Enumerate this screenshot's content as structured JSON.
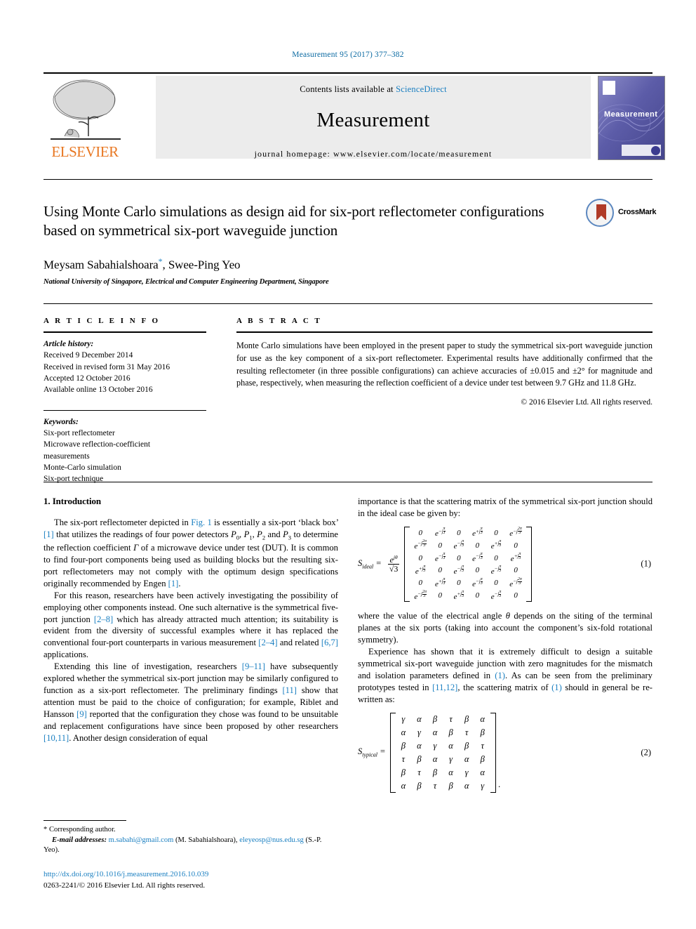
{
  "running_head": "Measurement 95 (2017) 377–382",
  "masthead": {
    "publisher": "ELSEVIER",
    "contents_prefix": "Contents lists available at ",
    "contents_link": "ScienceDirect",
    "journal_title": "Measurement",
    "homepage": "journal homepage: www.elsevier.com/locate/measurement",
    "cover_label": "Measurement"
  },
  "title_block": {
    "title": "Using Monte Carlo simulations as design aid for six-port reflectometer configurations based on symmetrical six-port waveguide junction",
    "authors_part1": "Meysam Sabahialshoara",
    "corresponding_marker": "*",
    "authors_part2": ", Swee-Ping Yeo",
    "affiliation": "National University of Singapore, Electrical and Computer Engineering Department, Singapore",
    "crossmark_label": "CrossMark"
  },
  "article_info": {
    "heading": "A R T I C L E   I N F O",
    "history_label": "Article history:",
    "history": [
      "Received 9 December 2014",
      "Received in revised form 31 May 2016",
      "Accepted 12 October 2016",
      "Available online 13 October 2016"
    ],
    "keywords_label": "Keywords:",
    "keywords": [
      "Six-port reflectometer",
      "Microwave reflection-coefficient",
      "measurements",
      "Monte-Carlo simulation",
      "Six-port technique"
    ]
  },
  "abstract": {
    "heading": "A B S T R A C T",
    "text": "Monte Carlo simulations have been employed in the present paper to study the symmetrical six-port waveguide junction for use as the key component of a six-port reflectometer. Experimental results have additionally confirmed that the resulting reflectometer (in three possible configurations) can achieve accuracies of ±0.015 and ±2° for magnitude and phase, respectively, when measuring the reflection coefficient of a device under test between 9.7 GHz and 11.8 GHz.",
    "copyright": "© 2016 Elsevier Ltd. All rights reserved."
  },
  "body": {
    "section1_heading": "1. Introduction",
    "left_paragraphs": [
      {
        "segments": [
          {
            "t": "The six-port reflectometer depicted in "
          },
          {
            "t": "Fig. 1",
            "s": "ref"
          },
          {
            "t": " is essentially a six-port ‘black box’ "
          },
          {
            "t": "[1]",
            "s": "ref"
          },
          {
            "t": " that utilizes the readings of four power detectors "
          },
          {
            "t": "P",
            "s": "it"
          },
          {
            "t": "0",
            "s": "sub"
          },
          {
            "t": ", "
          },
          {
            "t": "P",
            "s": "it"
          },
          {
            "t": "1",
            "s": "sub"
          },
          {
            "t": ", "
          },
          {
            "t": "P",
            "s": "it"
          },
          {
            "t": "2",
            "s": "sub"
          },
          {
            "t": " and "
          },
          {
            "t": "P",
            "s": "it"
          },
          {
            "t": "3",
            "s": "sub"
          },
          {
            "t": " to determine the reflection coefficient "
          },
          {
            "t": "Γ",
            "s": "it"
          },
          {
            "t": " of a microwave device under test (DUT). It is common to find four-port components being used as building blocks but the resulting six-port reflectometers may not comply with the optimum design specifications originally recommended by Engen "
          },
          {
            "t": "[1]",
            "s": "ref"
          },
          {
            "t": "."
          }
        ]
      },
      {
        "segments": [
          {
            "t": "For this reason, researchers have been actively investigating the possibility of employing other components instead. One such alternative is the symmetrical five-port junction "
          },
          {
            "t": "[2–8]",
            "s": "ref"
          },
          {
            "t": " which has already attracted much attention; its suitability is evident from the diversity of successful examples where it has replaced the conventional four-port counterparts in various measurement "
          },
          {
            "t": "[2–4]",
            "s": "ref"
          },
          {
            "t": " and related "
          },
          {
            "t": "[6,7]",
            "s": "ref"
          },
          {
            "t": " applications."
          }
        ]
      },
      {
        "segments": [
          {
            "t": "Extending this line of investigation, researchers "
          },
          {
            "t": "[9–11]",
            "s": "ref"
          },
          {
            "t": " have subsequently explored whether the symmetrical six-port junction may be similarly configured to function as a six-port reflectometer. The preliminary findings "
          },
          {
            "t": "[11]",
            "s": "ref"
          },
          {
            "t": " show that attention must be paid to the choice of configuration; for example, Riblet and Hansson "
          },
          {
            "t": "[9]",
            "s": "ref"
          },
          {
            "t": " reported that the configuration they chose was found to be unsuitable and replacement configurations have since been proposed by other researchers "
          },
          {
            "t": "[10,11]",
            "s": "ref"
          },
          {
            "t": ". Another design consideration of equal"
          }
        ]
      }
    ],
    "right_paragraph_top": {
      "segments": [
        {
          "t": "importance is that the scattering matrix of the symmetrical six-port junction should in the ideal case be given by:"
        }
      ]
    },
    "right_paragraphs_mid": [
      {
        "segments": [
          {
            "t": "where the value of the electrical angle "
          },
          {
            "t": "θ",
            "s": "it"
          },
          {
            "t": " depends on the siting of the terminal planes at the six ports (taking into account the component’s six-fold rotational symmetry)."
          }
        ]
      },
      {
        "segments": [
          {
            "t": "Experience has shown that it is extremely difficult to design a suitable symmetrical six-port waveguide junction with zero magnitudes for the mismatch and isolation parameters defined in "
          },
          {
            "t": "(1)",
            "s": "ref"
          },
          {
            "t": ". As can be seen from the preliminary prototypes tested in "
          },
          {
            "t": "[11,12]",
            "s": "ref"
          },
          {
            "t": ", the scattering matrix of "
          },
          {
            "t": "(1)",
            "s": "ref"
          },
          {
            "t": " should in general be re-written as:"
          }
        ]
      }
    ]
  },
  "equations": {
    "eq1": {
      "number": "(1)",
      "lhs": "S",
      "lhs_sub": "ideal",
      "prefactor_num": "e",
      "prefactor_num_sup": "jθ",
      "prefactor_den": "√3",
      "rows": [
        [
          "0",
          "e^-jπ/3",
          "0",
          "e^+jπ/3",
          "0",
          "e^-j2π/3"
        ],
        [
          "e^-j2π/3",
          "0",
          "e^-jπ/3",
          "0",
          "e^+jπ/3",
          "0"
        ],
        [
          "0",
          "e^-jπ/3",
          "0",
          "e^-jπ/3",
          "0",
          "e^+jπ/3"
        ],
        [
          "e^+jπ/3",
          "0",
          "e^-jπ/3",
          "0",
          "e^-jπ/3",
          "0"
        ],
        [
          "0",
          "e^+jπ/3",
          "0",
          "e^-jπ/3",
          "0",
          "e^-j2π/3"
        ],
        [
          "e^-j2π/3",
          "0",
          "e^+jπ/3",
          "0",
          "e^-jπ/3",
          "0"
        ]
      ]
    },
    "eq2": {
      "number": "(2)",
      "lhs": "S",
      "lhs_sub": "typical",
      "trailing": ".",
      "rows": [
        [
          "γ",
          "α",
          "β",
          "τ",
          "β",
          "α"
        ],
        [
          "α",
          "γ",
          "α",
          "β",
          "τ",
          "β"
        ],
        [
          "β",
          "α",
          "γ",
          "α",
          "β",
          "τ"
        ],
        [
          "τ",
          "β",
          "α",
          "γ",
          "α",
          "β"
        ],
        [
          "β",
          "τ",
          "β",
          "α",
          "γ",
          "α"
        ],
        [
          "α",
          "β",
          "τ",
          "β",
          "α",
          "γ"
        ]
      ]
    }
  },
  "footnote": {
    "star": "*",
    "corresponding": "Corresponding author.",
    "email_label": "E-mail addresses:",
    "email1": "m.sabahi@gmail.com",
    "email1_who": "(M. Sabahialshoara),",
    "email2": "eleyeosp@nus.edu.sg",
    "email2_who": "(S.-P. Yeo)."
  },
  "doi_block": {
    "doi": "http://dx.doi.org/10.1016/j.measurement.2016.10.039",
    "issn": "0263-2241/© 2016 Elsevier Ltd. All rights reserved."
  },
  "colors": {
    "link": "#1a7fc1",
    "elsevier_orange": "#E87722",
    "cover_purple": "#5b5ba8"
  }
}
